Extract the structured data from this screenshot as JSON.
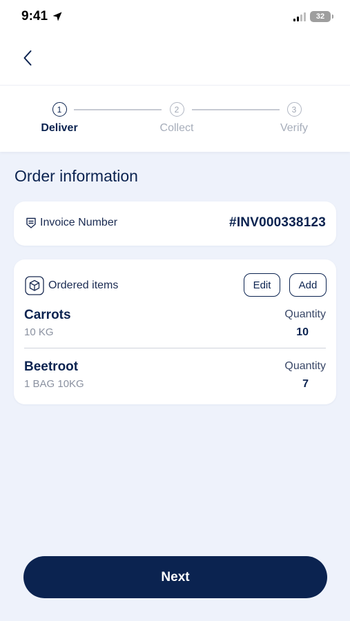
{
  "status_bar": {
    "time": "9:41",
    "battery": "32",
    "icons": [
      "location-arrow-icon",
      "signal-icon",
      "battery-icon"
    ]
  },
  "header": {
    "back_icon": "chevron-left-icon"
  },
  "stepper": {
    "steps": [
      {
        "number": "1",
        "label": "Deliver",
        "active": true
      },
      {
        "number": "2",
        "label": "Collect",
        "active": false
      },
      {
        "number": "3",
        "label": "Verify",
        "active": false
      }
    ]
  },
  "section_title": "Order information",
  "invoice": {
    "label": "Invoice Number",
    "value": "#INV000338123",
    "icon": "receipt-icon"
  },
  "ordered_items": {
    "label": "Ordered items",
    "icon": "box-icon",
    "edit_label": "Edit",
    "add_label": "Add",
    "items": [
      {
        "name": "Carrots",
        "unit": "10 KG",
        "quantity_label": "Quantity",
        "quantity": "10"
      },
      {
        "name": "Beetroot",
        "unit": "1 BAG 10KG",
        "quantity_label": "Quantity",
        "quantity": "7"
      }
    ]
  },
  "next_label": "Next",
  "colors": {
    "primary": "#0b2350",
    "background": "#eef2fb",
    "muted": "#a6adba"
  }
}
